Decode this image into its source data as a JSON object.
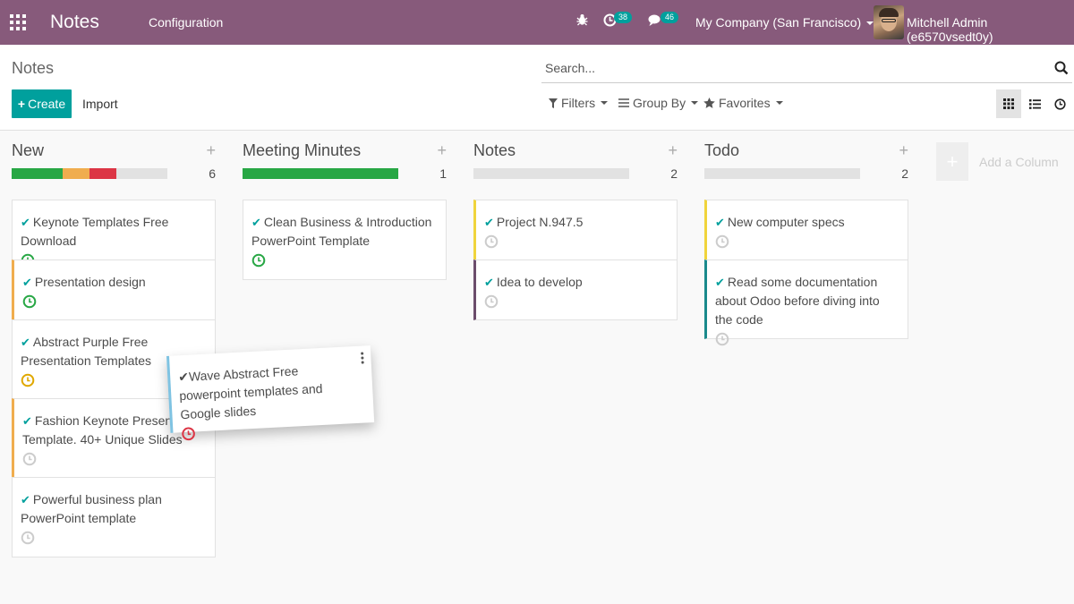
{
  "navbar": {
    "app_name": "Notes",
    "menu_configuration": "Configuration",
    "activity_count": "38",
    "message_count": "46",
    "company": "My Company (San Francisco)",
    "user": "Mitchell Admin (e6570vsedt0y)"
  },
  "control_panel": {
    "breadcrumb": "Notes",
    "search_placeholder": "Search...",
    "create_label": "Create",
    "import_label": "Import",
    "filters_label": "Filters",
    "groupby_label": "Group By",
    "favorites_label": "Favorites"
  },
  "columns": [
    {
      "title": "New",
      "count": "6",
      "progress": [
        {
          "color": "#28a745",
          "pct": 33
        },
        {
          "color": "#f0ad4e",
          "pct": 17
        },
        {
          "color": "#dc3545",
          "pct": 17
        }
      ],
      "cards": [
        {
          "title": "Keynote Templates Free Download",
          "activity": "overdue-green"
        },
        {
          "title": "Presentation design",
          "activity": "green"
        },
        {
          "title": "Abstract Purple Free Presentation Templates",
          "activity": "warning"
        },
        {
          "title": "Fashion Keynote Presentation Template. 40+ Unique Slides",
          "activity": "none"
        },
        {
          "title": "Powerful business plan PowerPoint template",
          "activity": "none"
        }
      ]
    },
    {
      "title": "Meeting Minutes",
      "count": "1",
      "progress": [
        {
          "color": "#28a745",
          "pct": 100
        }
      ],
      "cards": [
        {
          "title": "Clean Business & Introduction PowerPoint Template",
          "activity": "green"
        }
      ]
    },
    {
      "title": "Notes",
      "count": "2",
      "progress": [],
      "cards": [
        {
          "title": "Project N.947.5",
          "activity": "none"
        },
        {
          "title": "Idea to develop",
          "activity": "none"
        }
      ]
    },
    {
      "title": "Todo",
      "count": "2",
      "progress": [],
      "cards": [
        {
          "title": "New computer specs",
          "activity": "none"
        },
        {
          "title": "Read some documentation about Odoo before diving into the code",
          "activity": "none"
        }
      ]
    }
  ],
  "add_column_label": "Add a Column",
  "dragged_card": {
    "title": "Wave Abstract Free powerpoint templates and Google slides",
    "activity": "danger"
  },
  "colors": {
    "navbar": "#875a7b",
    "primary": "#00a09d",
    "success": "#28a745",
    "warning": "#f0ad4e",
    "danger": "#dc3545"
  }
}
